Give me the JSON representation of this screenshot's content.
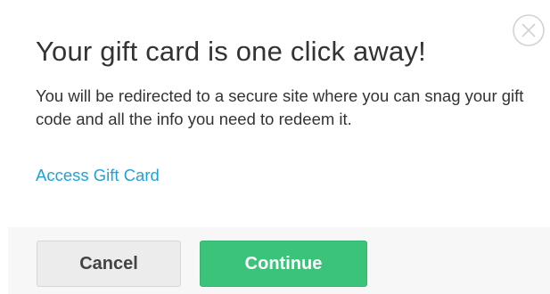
{
  "dialog": {
    "title": "Your gift card is one click away!",
    "body": "You will be redirected to a secure site where you can snag your gift code and all the info you need to redeem it.",
    "link_label": "Access Gift Card",
    "close_icon": "close-icon"
  },
  "footer": {
    "cancel_label": "Cancel",
    "continue_label": "Continue"
  },
  "colors": {
    "link": "#1fa2d8",
    "primary_button": "#3cc37a",
    "secondary_button": "#ececec",
    "footer_background": "#f7f7f7"
  }
}
